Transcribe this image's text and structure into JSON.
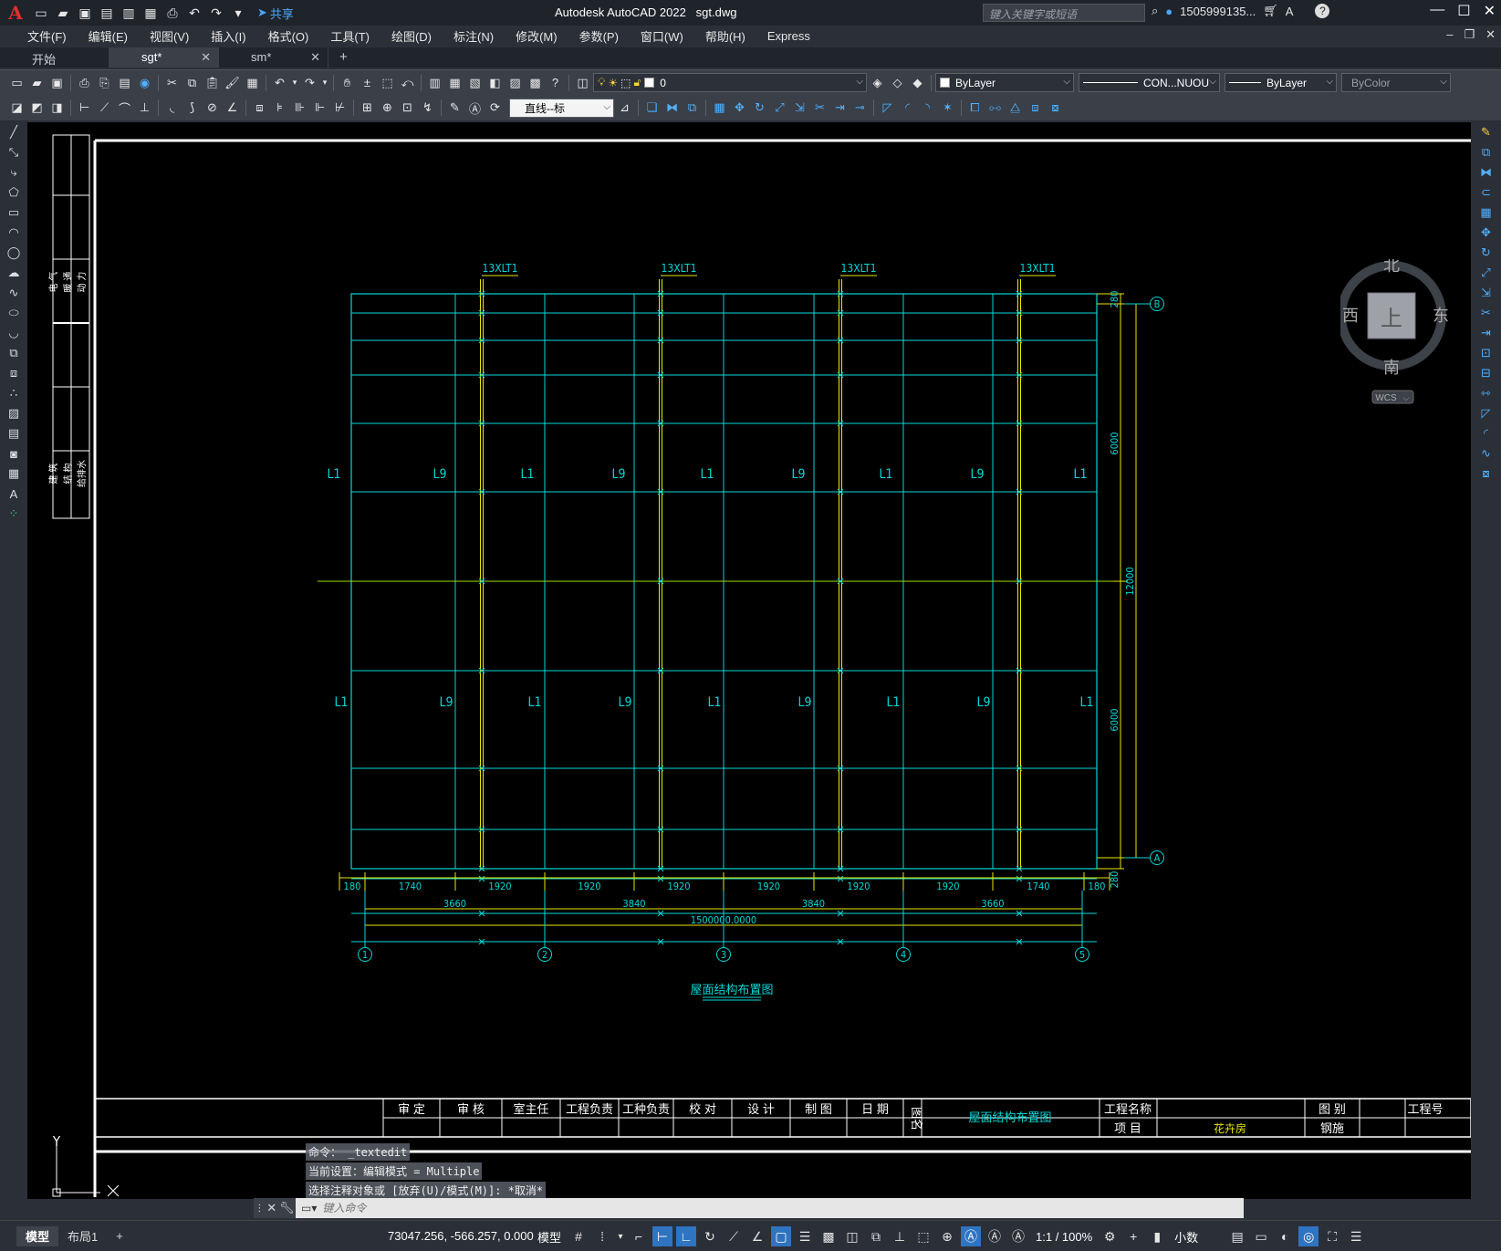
{
  "titlebar": {
    "app_letter": "A",
    "share_label": "共享",
    "app_name": "Autodesk AutoCAD 2022",
    "file_name": "sgt.dwg",
    "search_placeholder": "键入关键字或短语",
    "user": "1505999135...",
    "help": "?"
  },
  "menu": [
    "文件(F)",
    "编辑(E)",
    "视图(V)",
    "插入(I)",
    "格式(O)",
    "工具(T)",
    "绘图(D)",
    "标注(N)",
    "修改(M)",
    "参数(P)",
    "窗口(W)",
    "帮助(H)",
    "Express"
  ],
  "tabs": [
    {
      "label": "开始",
      "active": false,
      "closable": false
    },
    {
      "label": "sgt*",
      "active": true,
      "closable": true
    },
    {
      "label": "sm*",
      "active": false,
      "closable": true
    }
  ],
  "properties": {
    "layer": "0",
    "color": "ByLayer",
    "linetype": "CON...NUOU",
    "lineweight": "ByLayer",
    "plotstyle": "ByColor",
    "dimstyle": "直线--标"
  },
  "viewcube": {
    "north": "北",
    "south": "南",
    "west": "西",
    "east": "东",
    "face": "上",
    "ucs": "WCS"
  },
  "drawing": {
    "column_labels": [
      "13XLT1",
      "13XLT1",
      "13XLT1",
      "13XLT1"
    ],
    "beam_row_top": [
      "L1",
      "L9",
      "L1",
      "L9",
      "L1",
      "L9",
      "L1",
      "L9",
      "L1"
    ],
    "beam_row_bottom": [
      "L1",
      "L9",
      "L1",
      "L9",
      "L1",
      "L9",
      "L1",
      "L9",
      "L1"
    ],
    "dims_row1": [
      "180",
      "1740",
      "1920",
      "1920",
      "1920",
      "1920",
      "1920",
      "1920",
      "1740",
      "180"
    ],
    "dims_row2": [
      "3660",
      "3840",
      "3840",
      "3660"
    ],
    "dim_total": "1500000.0000",
    "dims_right": [
      "280",
      "6000",
      "12000",
      "6000",
      "280"
    ],
    "axis_numbers": [
      "1",
      "2",
      "3",
      "4",
      "5"
    ],
    "axis_letters": [
      "B",
      "A"
    ],
    "drawing_title": "屋面结构布置图",
    "side_table": [
      "电 气",
      "暖 通",
      "动 力",
      "建 筑",
      "结 构",
      "给排水"
    ],
    "title_block": {
      "headers": [
        "审 定",
        "审 核",
        "室主任",
        "工程负责",
        "工种负责",
        "校 对",
        "设 计",
        "制 图",
        "日 期"
      ],
      "figure_name_label": "图名",
      "figure_name": "屋面结构布置图",
      "project_name_label": "工程名称",
      "project_label": "项 目",
      "project_value": "花卉房",
      "type_label": "图 别",
      "type_value": "钢施",
      "number_label": "工程号"
    },
    "ucs_y": "Y"
  },
  "command": {
    "history": [
      "命令： _textedit",
      "当前设置：编辑模式 = Multiple",
      "选择注释对象或 [放弃(U)/模式(M)]: *取消*"
    ],
    "placeholder": "键入命令"
  },
  "status": {
    "layout_tabs": [
      "模型",
      "布局1"
    ],
    "coords": "73047.256, -566.257, 0.000",
    "model": "模型",
    "scale": "1:1 / 100%",
    "units": "小数"
  }
}
